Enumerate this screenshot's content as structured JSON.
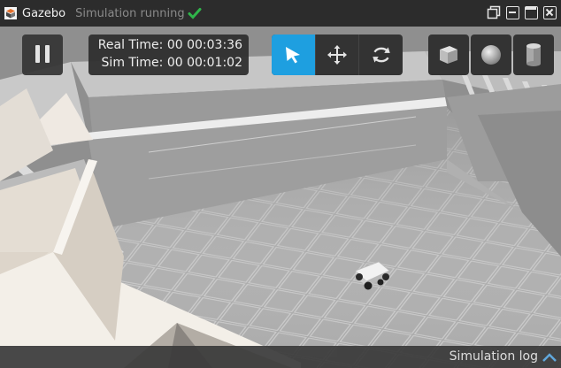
{
  "window": {
    "title": "Gazebo",
    "status": "Simulation running"
  },
  "time": {
    "real_label": "Real Time:",
    "real_value": "00 00:03:36",
    "sim_label": "Sim Time:",
    "sim_value": "00 00:01:02"
  },
  "toolbar": {
    "tools": [
      "select-arrow-icon",
      "translate-icon",
      "rotate-icon"
    ],
    "active_tool": "select-arrow-icon"
  },
  "insert_shapes": [
    "box-icon",
    "sphere-icon",
    "cylinder-icon"
  ],
  "log": {
    "label": "Simulation log"
  },
  "colors": {
    "accent": "#1e9fe0",
    "status_ok": "#2fb54a",
    "titlebar": "#2c2c2c"
  }
}
